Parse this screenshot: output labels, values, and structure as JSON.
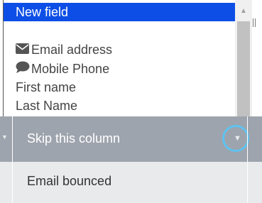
{
  "listbox": {
    "items": [
      {
        "label": "New field",
        "icon": "",
        "selected": true
      },
      {
        "label": "Email address",
        "icon": "envelope-icon",
        "selected": false
      },
      {
        "label": "Mobile Phone",
        "icon": "chat-icon",
        "selected": false
      },
      {
        "label": "First name",
        "icon": "",
        "selected": false
      },
      {
        "label": "Last Name",
        "icon": "",
        "selected": false
      }
    ]
  },
  "table": {
    "header": {
      "column_label": "Skip this column"
    },
    "rows": [
      {
        "value": "Email bounced"
      }
    ]
  },
  "colors": {
    "selection": "#0d4fe6",
    "header_bg": "#9ea4ad",
    "highlight_ring": "#5ec3f1",
    "row_bg": "#e9eaec"
  }
}
